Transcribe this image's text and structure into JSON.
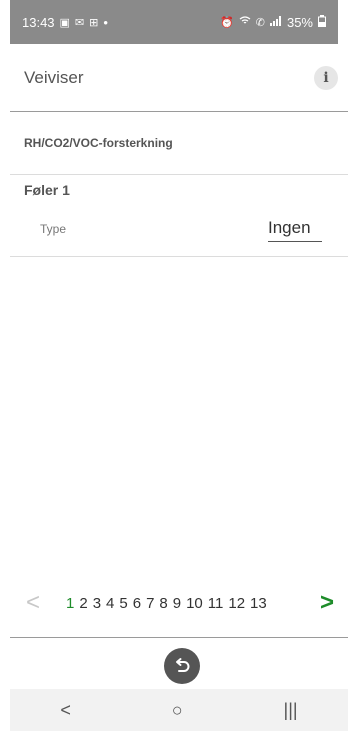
{
  "status_bar": {
    "time": "13:43",
    "dot": "•",
    "battery": "35%"
  },
  "header": {
    "title": "Veiviser",
    "info_label": "i"
  },
  "section": {
    "title": "RH/CO2/VOC-forsterkning"
  },
  "group": {
    "title": "Føler 1"
  },
  "field": {
    "label": "Type",
    "value": "Ingen"
  },
  "pager": {
    "prev": "<",
    "next": ">",
    "pages": [
      "1",
      "2",
      "3",
      "4",
      "5",
      "6",
      "7",
      "8",
      "9",
      "10",
      "11",
      "12",
      "13"
    ],
    "current": "1"
  },
  "nav": {
    "back": "<",
    "home": "○",
    "recents": "|||"
  },
  "colors": {
    "accent": "#1e8c2a",
    "status_bar": "#8a8a8a"
  }
}
